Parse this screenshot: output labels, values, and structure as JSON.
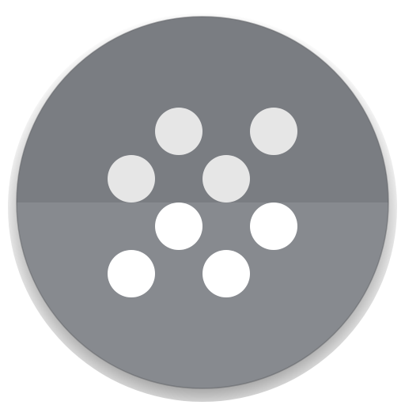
{
  "app_icon": {
    "icon": "dot-grid-launcher-icon",
    "colors": {
      "background_top": "#7a7d82",
      "background_bottom": "#878a8f",
      "edge_shadow": "#5e6064",
      "dot_upper": "#e6e6e6",
      "dot_lower": "#ffffff"
    },
    "dot_count": 8
  }
}
